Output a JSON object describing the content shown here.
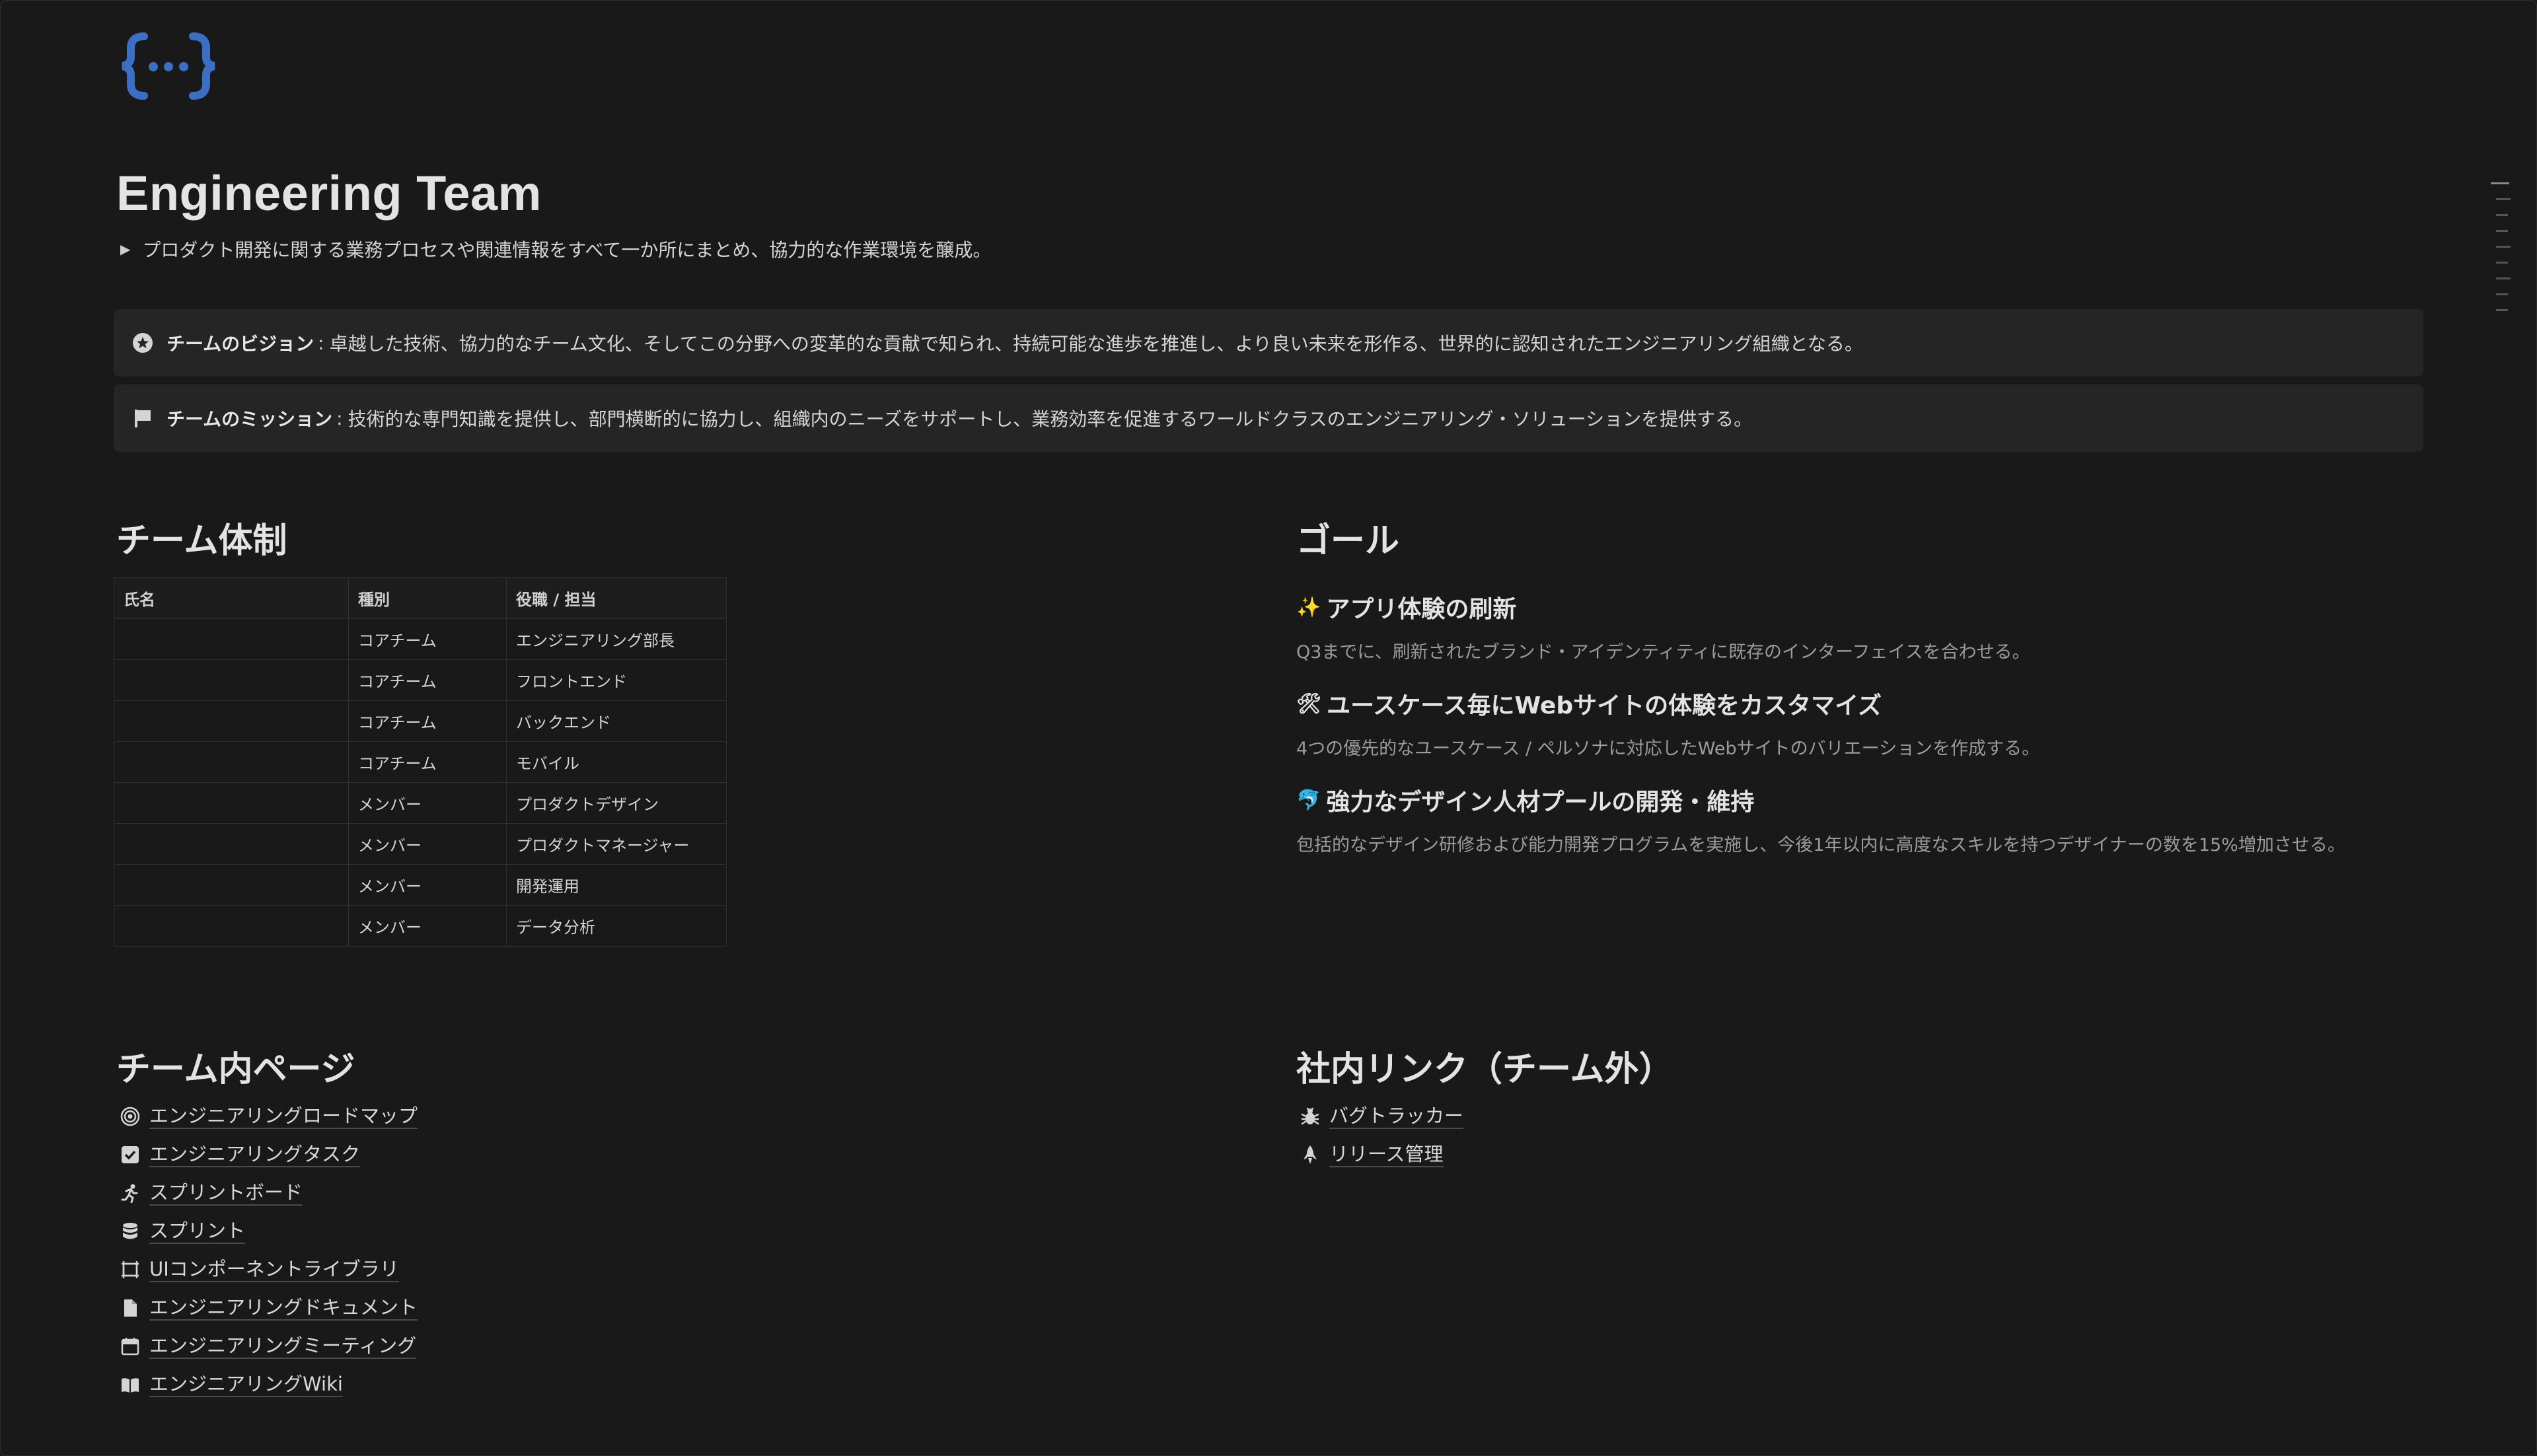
{
  "page": {
    "title": "Engineering Team",
    "summary_toggle": "プロダクト開発に関する業務プロセスや関連情報をすべて一か所にまとめ、協力的な作業環境を醸成。"
  },
  "callouts": [
    {
      "icon": "star-circle-icon",
      "label": "チームのビジョン",
      "text": "卓越した技術、協力的なチーム文化、そしてこの分野への変革的な貢献で知られ、持続可能な進歩を推進し、より良い未来を形作る、世界的に認知されたエンジニアリング組織となる。"
    },
    {
      "icon": "flag-icon",
      "label": "チームのミッション",
      "text": "技術的な専門知識を提供し、部門横断的に協力し、組織内のニーズをサポートし、業務効率を促進するワールドクラスのエンジニアリング・ソリューションを提供する。"
    }
  ],
  "team": {
    "heading": "チーム体制",
    "columns": [
      "氏名",
      "種別",
      "役職 / 担当"
    ],
    "rows": [
      [
        "",
        "コアチーム",
        "エンジニアリング部長"
      ],
      [
        "",
        "コアチーム",
        "フロントエンド"
      ],
      [
        "",
        "コアチーム",
        "バックエンド"
      ],
      [
        "",
        "コアチーム",
        "モバイル"
      ],
      [
        "",
        "メンバー",
        "プロダクトデザイン"
      ],
      [
        "",
        "メンバー",
        "プロダクトマネージャー"
      ],
      [
        "",
        "メンバー",
        "開発運用"
      ],
      [
        "",
        "メンバー",
        "データ分析"
      ]
    ]
  },
  "goals": {
    "heading": "ゴール",
    "items": [
      {
        "emoji": "✨",
        "title": "アプリ体験の刷新",
        "desc": "Q3までに、刷新されたブランド・アイデンティティに既存のインターフェイスを合わせる。"
      },
      {
        "emoji": "🛠",
        "title": "ユースケース毎にWebサイトの体験をカスタマイズ",
        "desc": "4つの優先的なユースケース / ペルソナに対応したWebサイトのバリエーションを作成する。"
      },
      {
        "emoji": "🐬",
        "title": "強力なデザイン人材プールの開発・維持",
        "desc": "包括的なデザイン研修および能力開発プログラムを実施し、今後1年以内に高度なスキルを持つデザイナーの数を15%増加させる。"
      }
    ]
  },
  "internal_pages": {
    "heading": "チーム内ページ",
    "items": [
      {
        "icon": "target-icon",
        "label": "エンジニアリングロードマップ"
      },
      {
        "icon": "checkbox-icon",
        "label": "エンジニアリングタスク"
      },
      {
        "icon": "runner-icon",
        "label": "スプリントボード"
      },
      {
        "icon": "database-icon",
        "label": "スプリント"
      },
      {
        "icon": "frame-icon",
        "label": "UIコンポーネントライブラリ"
      },
      {
        "icon": "document-icon",
        "label": "エンジニアリングドキュメント"
      },
      {
        "icon": "calendar-icon",
        "label": "エンジニアリングミーティング"
      },
      {
        "icon": "book-icon",
        "label": "エンジニアリングWiki"
      }
    ]
  },
  "external_links": {
    "heading": "社内リンク（チーム外）",
    "items": [
      {
        "icon": "bug-icon",
        "label": "バグトラッカー"
      },
      {
        "icon": "rocket-icon",
        "label": "リリース管理"
      }
    ]
  },
  "colors": {
    "background": "#191919",
    "callout_bg": "#252525",
    "logo_blue": "#3b6fc4"
  }
}
